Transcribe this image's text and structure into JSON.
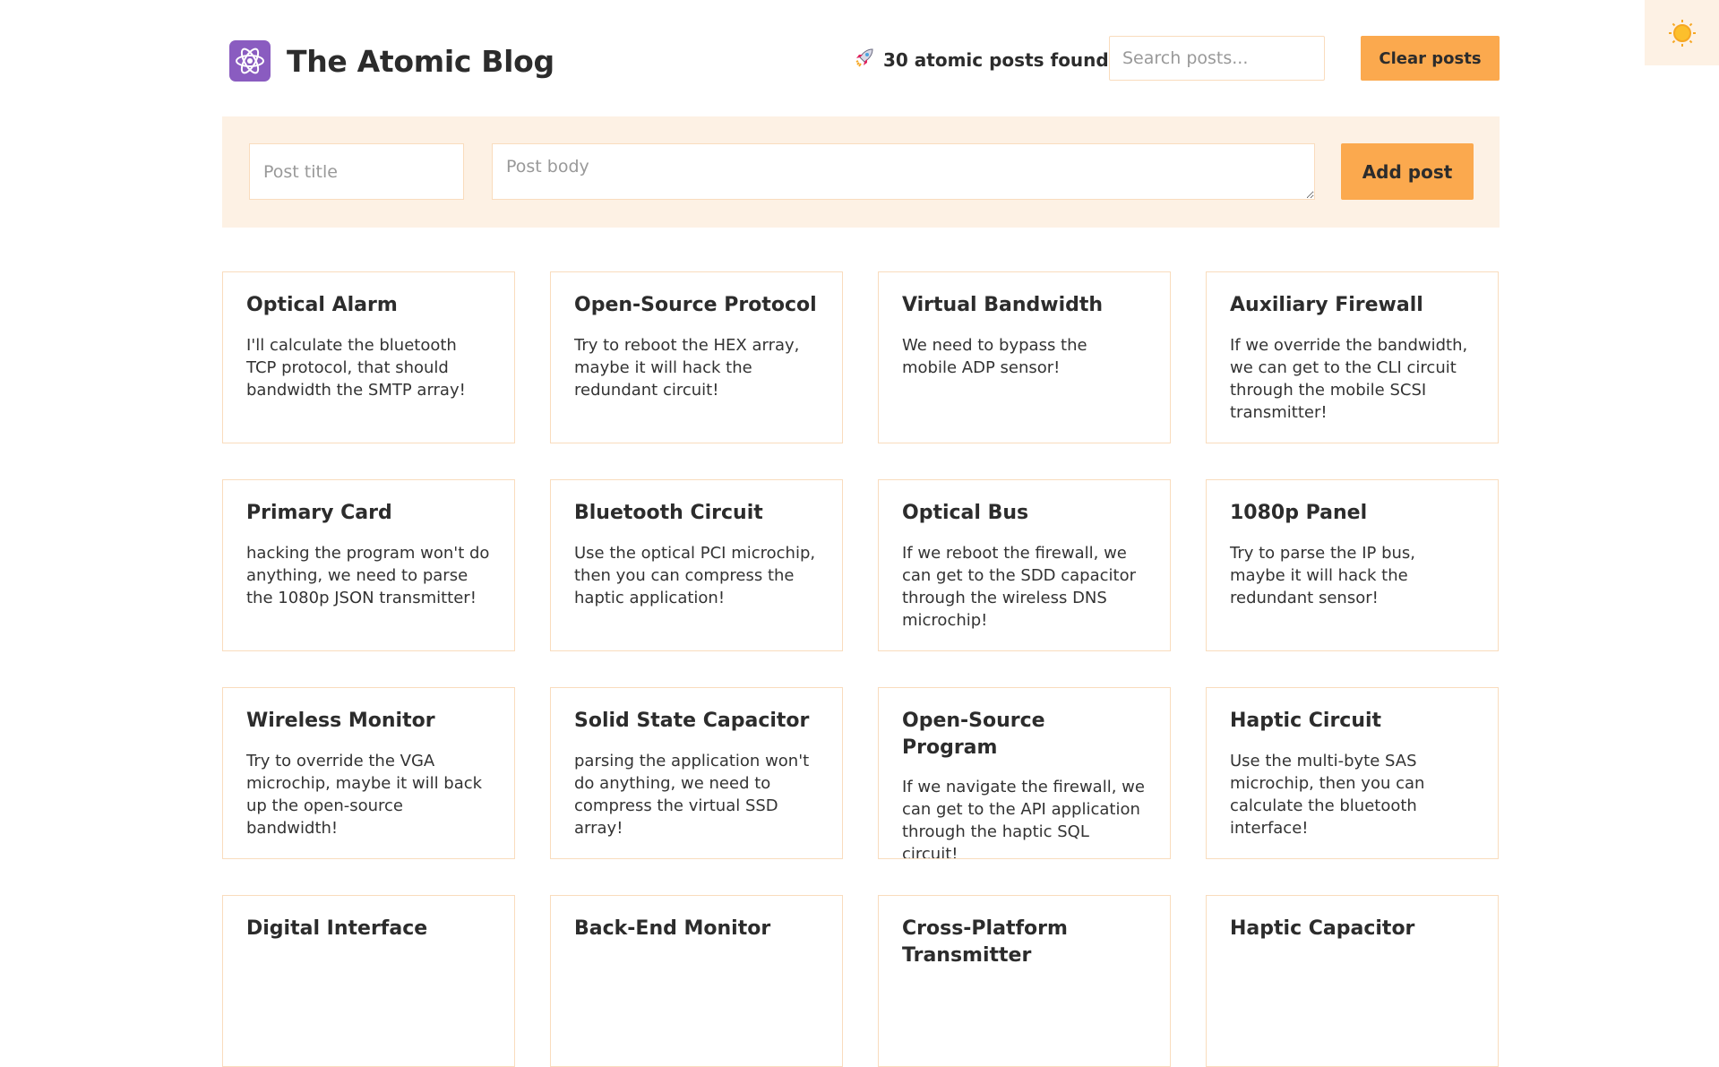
{
  "header": {
    "logo_icon": "atom-icon",
    "title": "The Atomic Blog",
    "post_count_icon": "rocket-icon",
    "post_count_text": "30 atomic posts found",
    "search_placeholder": "Search posts...",
    "clear_label": "Clear posts"
  },
  "theme_toggle": {
    "icon": "sun-icon",
    "color": "#f6a723"
  },
  "form": {
    "title_placeholder": "Post title",
    "body_placeholder": "Post body",
    "add_label": "Add post"
  },
  "colors": {
    "accent": "#fba94e",
    "panel_bg": "#fdf1e4",
    "border": "#f9dcbd",
    "logo_bg": "#8a5cc0"
  },
  "posts": [
    {
      "title": "Optical Alarm",
      "body": "I'll calculate the bluetooth TCP protocol, that should bandwidth the SMTP array!"
    },
    {
      "title": "Open-Source Protocol",
      "body": "Try to reboot the HEX array, maybe it will hack the redundant circuit!"
    },
    {
      "title": "Virtual Bandwidth",
      "body": "We need to bypass the mobile ADP sensor!"
    },
    {
      "title": "Auxiliary Firewall",
      "body": "If we override the bandwidth, we can get to the CLI circuit through the mobile SCSI transmitter!"
    },
    {
      "title": "Primary Card",
      "body": "hacking the program won't do anything, we need to parse the 1080p JSON transmitter!"
    },
    {
      "title": "Bluetooth Circuit",
      "body": "Use the optical PCI microchip, then you can compress the haptic application!"
    },
    {
      "title": "Optical Bus",
      "body": "If we reboot the firewall, we can get to the SDD capacitor through the wireless DNS microchip!"
    },
    {
      "title": "1080p Panel",
      "body": "Try to parse the IP bus, maybe it will hack the redundant sensor!"
    },
    {
      "title": "Wireless Monitor",
      "body": "Try to override the VGA microchip, maybe it will back up the open-source bandwidth!"
    },
    {
      "title": "Solid State Capacitor",
      "body": "parsing the application won't do anything, we need to compress the virtual SSD array!"
    },
    {
      "title": "Open-Source Program",
      "body": "If we navigate the firewall, we can get to the API application through the haptic SQL circuit!"
    },
    {
      "title": "Haptic Circuit",
      "body": "Use the multi-byte SAS microchip, then you can calculate the bluetooth interface!"
    },
    {
      "title": "Digital Interface",
      "body": ""
    },
    {
      "title": "Back-End Monitor",
      "body": ""
    },
    {
      "title": "Cross-Platform Transmitter",
      "body": ""
    },
    {
      "title": "Haptic Capacitor",
      "body": ""
    }
  ]
}
